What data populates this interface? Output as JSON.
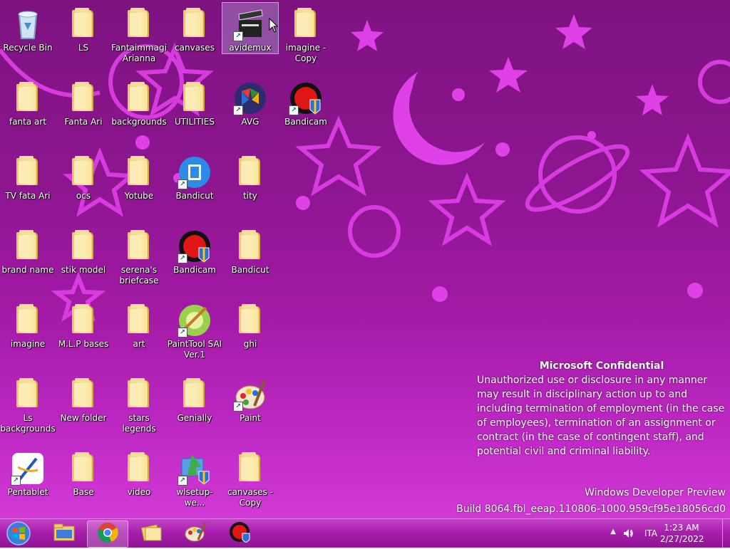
{
  "desktop": {
    "icons": [
      {
        "label": "Recycle Bin",
        "icon": "recycle-bin-icon",
        "type": "recycle",
        "selected": false
      },
      {
        "label": "LS",
        "icon": "folder-icon",
        "type": "folder",
        "selected": false
      },
      {
        "label": "Fantaimmagi Arianna",
        "icon": "folder-icon",
        "type": "folder",
        "selected": false
      },
      {
        "label": "canvases",
        "icon": "folder-icon",
        "type": "folder",
        "selected": false
      },
      {
        "label": "avidemux",
        "icon": "clapperboard-icon",
        "type": "app",
        "selected": true
      },
      {
        "label": "imagine - Copy",
        "icon": "folder-icon",
        "type": "folder",
        "selected": false
      },
      {
        "label": "fanta art",
        "icon": "folder-icon",
        "type": "folder",
        "selected": false
      },
      {
        "label": "Fanta Ari",
        "icon": "folder-icon",
        "type": "folder",
        "selected": false
      },
      {
        "label": "backgrounds",
        "icon": "folder-icon",
        "type": "folder",
        "selected": false
      },
      {
        "label": "UTILITIES",
        "icon": "folder-icon",
        "type": "folder",
        "selected": false
      },
      {
        "label": "AVG",
        "icon": "avg-icon",
        "type": "app",
        "selected": false
      },
      {
        "label": "Bandicam",
        "icon": "bandicam-icon",
        "type": "app",
        "selected": false
      },
      {
        "label": "TV fata Ari",
        "icon": "folder-icon",
        "type": "folder",
        "selected": false
      },
      {
        "label": "ocs",
        "icon": "folder-icon",
        "type": "folder",
        "selected": false
      },
      {
        "label": "Yotube",
        "icon": "folder-icon",
        "type": "folder",
        "selected": false
      },
      {
        "label": "Bandicut",
        "icon": "bandicut-icon",
        "type": "app",
        "selected": false
      },
      {
        "label": "tity",
        "icon": "folder-icon",
        "type": "folder",
        "selected": false
      },
      {
        "label": "brand name",
        "icon": "folder-icon",
        "type": "folder",
        "selected": false
      },
      {
        "label": "stik model",
        "icon": "folder-icon",
        "type": "folder",
        "selected": false
      },
      {
        "label": "serena's briefcase",
        "icon": "folder-icon",
        "type": "folder",
        "selected": false
      },
      {
        "label": "Bandicam",
        "icon": "bandicam-icon",
        "type": "app",
        "selected": false
      },
      {
        "label": "Bandicut",
        "icon": "folder-icon",
        "type": "folder",
        "selected": false
      },
      {
        "label": "imagine",
        "icon": "folder-icon",
        "type": "folder",
        "selected": false
      },
      {
        "label": "M.L.P bases",
        "icon": "folder-icon",
        "type": "folder",
        "selected": false
      },
      {
        "label": "art",
        "icon": "folder-icon",
        "type": "folder",
        "selected": false
      },
      {
        "label": "PaintTool SAI Ver.1",
        "icon": "painttool-sai-icon",
        "type": "app",
        "selected": false
      },
      {
        "label": "ghi",
        "icon": "folder-icon",
        "type": "folder",
        "selected": false
      },
      {
        "label": "Ls backgrounds",
        "icon": "folder-icon",
        "type": "folder",
        "selected": false
      },
      {
        "label": "New folder",
        "icon": "folder-icon",
        "type": "folder",
        "selected": false
      },
      {
        "label": "stars legends",
        "icon": "folder-icon",
        "type": "folder",
        "selected": false
      },
      {
        "label": "Genially",
        "icon": "folder-icon",
        "type": "folder",
        "selected": false
      },
      {
        "label": "Paint",
        "icon": "paint-palette-icon",
        "type": "app",
        "selected": false
      },
      {
        "label": "Pentablet",
        "icon": "pentablet-icon",
        "type": "app",
        "selected": false
      },
      {
        "label": "Base",
        "icon": "folder-icon",
        "type": "folder",
        "selected": false
      },
      {
        "label": "video",
        "icon": "folder-icon",
        "type": "folder",
        "selected": false
      },
      {
        "label": "wlsetup-we...",
        "icon": "wlsetup-icon",
        "type": "app",
        "selected": false
      },
      {
        "label": "canvases - Copy",
        "icon": "folder-icon",
        "type": "folder",
        "selected": false
      }
    ]
  },
  "watermark": {
    "confidential_title": "Microsoft Confidential",
    "confidential_body": "Unauthorized use or disclosure in any manner may result in disciplinary action up to and including termination of employment (in the case of employees), termination of an assignment or contract (in the case of contingent staff), and potential civil and criminal liability.",
    "product": "Windows Developer Preview",
    "build": "Build 8064.fbl_eeap.110806-1000.959cf95e18056cd0"
  },
  "taskbar": {
    "buttons": [
      {
        "name": "file-explorer",
        "icon": "file-explorer-icon",
        "active": false
      },
      {
        "name": "chrome",
        "icon": "chrome-icon",
        "active": true
      },
      {
        "name": "folders",
        "icon": "folder-stack-icon",
        "active": false
      },
      {
        "name": "paint",
        "icon": "paint-palette-icon",
        "active": false
      },
      {
        "name": "bandicam",
        "icon": "bandicam-icon",
        "active": false
      }
    ],
    "tray": {
      "language": "ITA",
      "time": "1:23 AM",
      "date": "2/27/2022"
    }
  },
  "colors": {
    "wallpaper": "#8d1690",
    "decor": "#e040e8",
    "taskbar": "#a81fae"
  }
}
